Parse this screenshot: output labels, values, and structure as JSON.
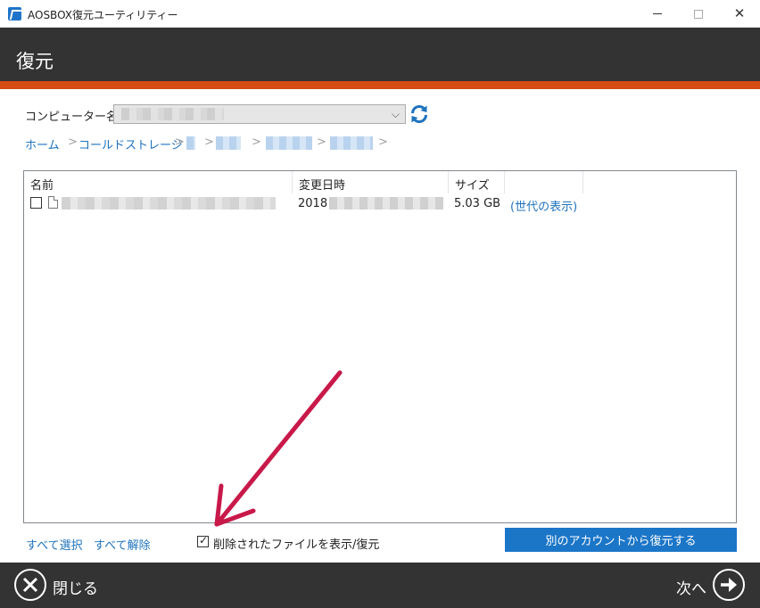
{
  "window": {
    "title": "AOSBOX復元ユーティリティー"
  },
  "header": {
    "title": "復元"
  },
  "computer": {
    "label": "コンピューター名:"
  },
  "breadcrumb": {
    "home": "ホーム",
    "cold_storage": "コールドストレージ",
    "separator": ">"
  },
  "list": {
    "columns": {
      "name": "名前",
      "modified": "変更日時",
      "size": "サイズ"
    },
    "rows": [
      {
        "date_prefix": "2018",
        "size": "5.03 GB",
        "generations_link": "(世代の表示)"
      }
    ]
  },
  "footer": {
    "select_all": "すべて選択",
    "deselect_all": "すべて解除",
    "show_deleted_label": "削除されたファイルを表示/復元",
    "restore_other_account": "別のアカウントから復元する"
  },
  "bottombar": {
    "close_label": "閉じる",
    "next_label": "次へ"
  },
  "colors": {
    "header_bg": "#333333",
    "accent": "#d44b14",
    "link": "#1e73be",
    "primary_button": "#1c76c8",
    "annotation_arrow": "#c8194a"
  },
  "icons": [
    "app-icon",
    "chevron-down-icon",
    "refresh-icon",
    "file-icon",
    "close-circle-icon",
    "arrow-right-circle-icon",
    "annotation-arrow"
  ]
}
